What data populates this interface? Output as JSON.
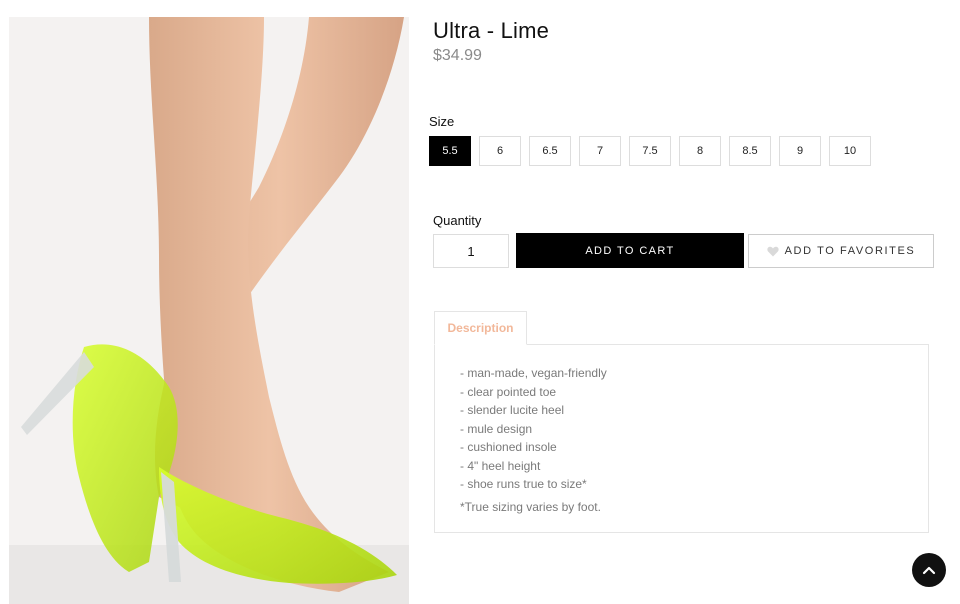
{
  "product": {
    "title": "Ultra - Lime",
    "price": "$34.99",
    "image_alt": "product-photo"
  },
  "size": {
    "label": "Size",
    "options": [
      "5.5",
      "6",
      "6.5",
      "7",
      "7.5",
      "8",
      "8.5",
      "9",
      "10"
    ],
    "selected": "5.5"
  },
  "quantity": {
    "label": "Quantity",
    "value": "1"
  },
  "actions": {
    "add_to_cart": "ADD TO CART",
    "add_to_favorites": "ADD TO FAVORITES"
  },
  "description": {
    "tab_label": "Description",
    "items": [
      "- man-made, vegan-friendly",
      "- clear pointed toe",
      "- slender lucite heel",
      "- mule design",
      "- cushioned insole",
      "- 4\" heel height",
      "- shoe runs true to size*"
    ],
    "note": "*True sizing varies by foot."
  },
  "colors": {
    "accent_tab": "#f2b89a",
    "button_primary": "#000000",
    "shoe_lime": "#c6f01f",
    "muted_text": "#7a7a7a"
  },
  "icons": {
    "favorites": "heart-icon",
    "back_to_top": "chevron-up-icon"
  }
}
